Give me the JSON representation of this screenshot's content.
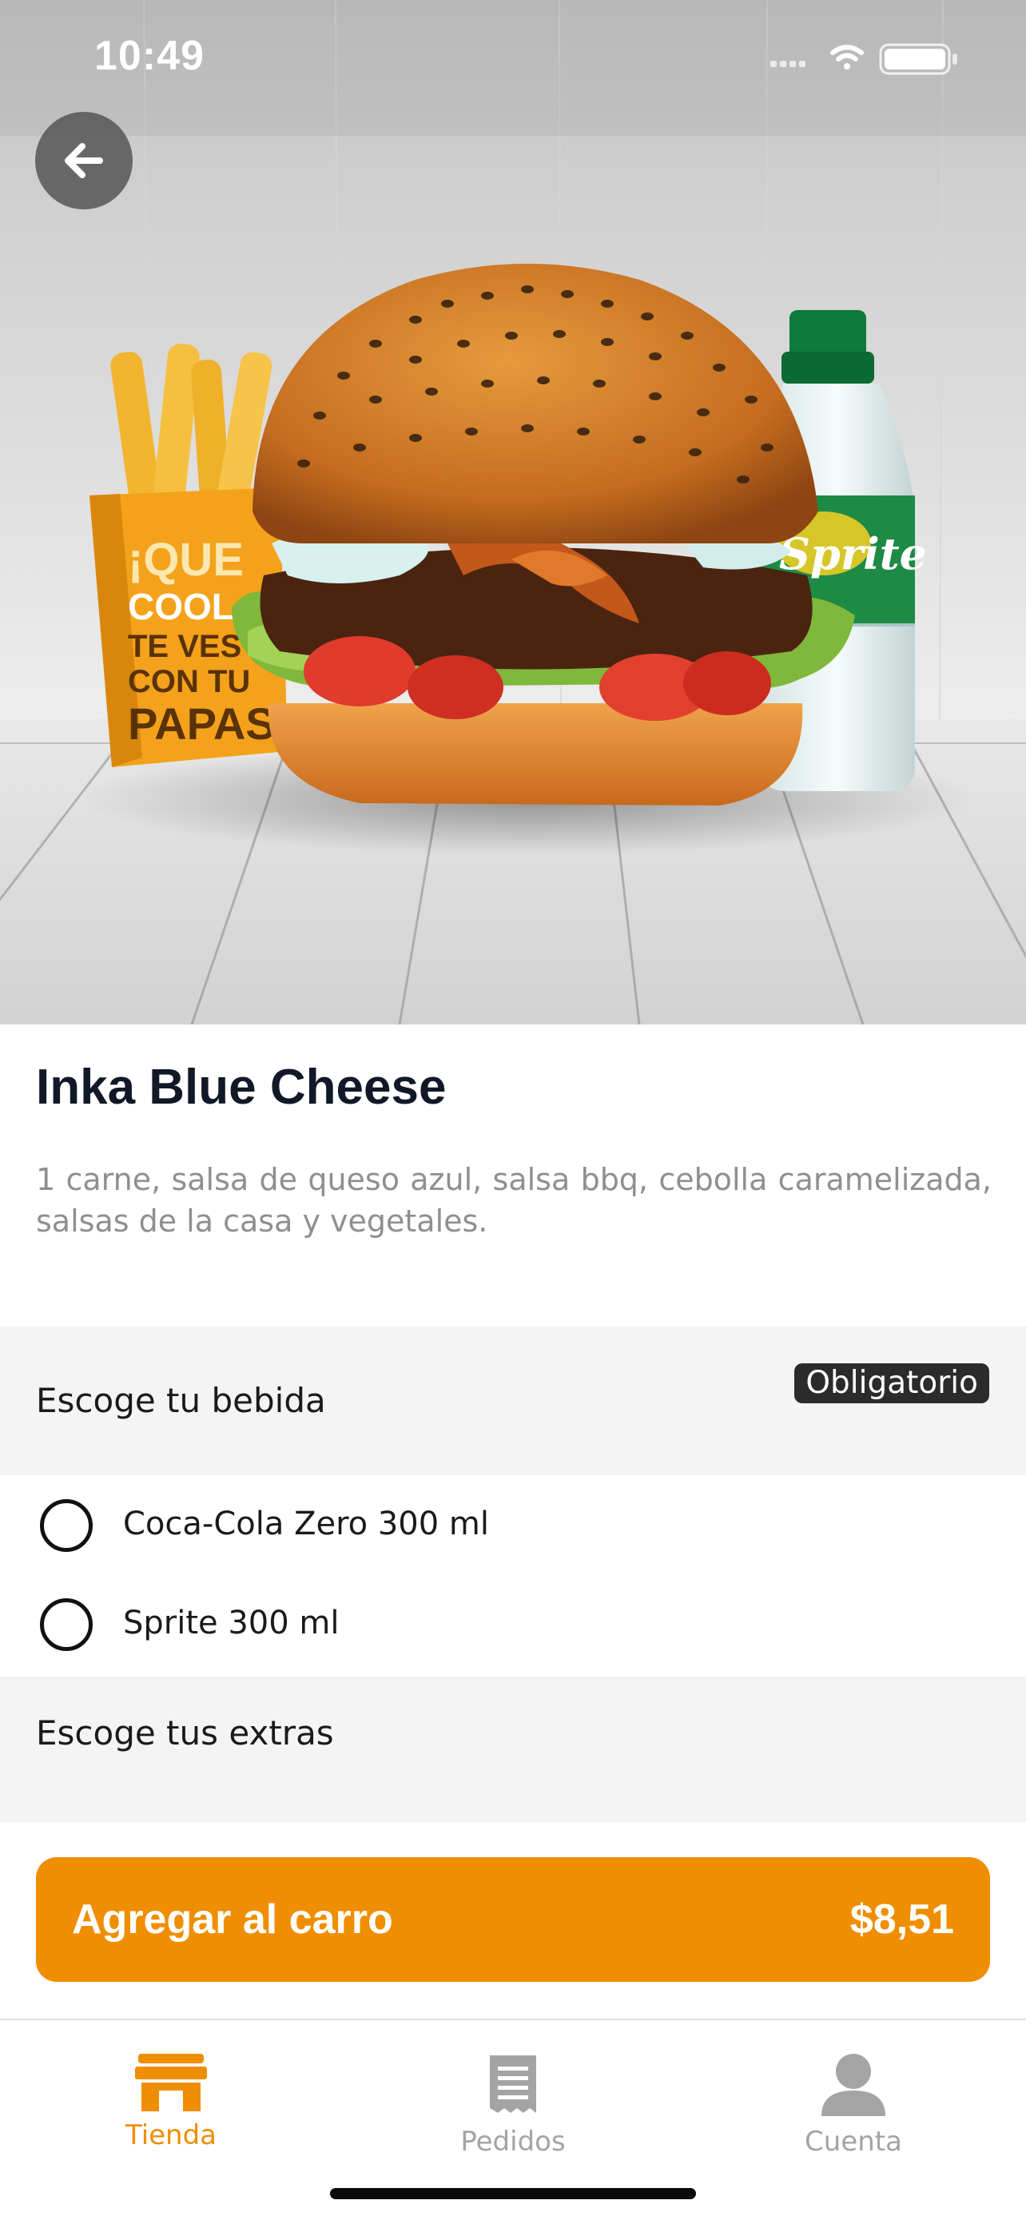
{
  "status_bar": {
    "time": "10:49",
    "icons": [
      "signal-icon",
      "wifi-icon",
      "battery-icon"
    ]
  },
  "header": {
    "back_icon": "arrow-left-icon"
  },
  "product": {
    "name": "Inka Blue Cheese",
    "description": "1 carne, salsa de queso azul, salsa bbq, cebolla caramelizada, salsas de la casa y vegetales."
  },
  "drink_section": {
    "label": "Escoge tu bebida",
    "badge": "Obligatorio",
    "options": [
      {
        "label": "Coca-Cola Zero 300 ml",
        "selected": false
      },
      {
        "label": "Sprite 300 ml",
        "selected": false
      }
    ]
  },
  "extras_section": {
    "label": "Escoge tus extras"
  },
  "cart_button": {
    "label": "Agregar al carro",
    "price": "$8,51"
  },
  "tabbar": {
    "tabs": [
      {
        "label": "Tienda",
        "icon": "store-icon",
        "active": true
      },
      {
        "label": "Pedidos",
        "icon": "receipt-icon",
        "active": false
      },
      {
        "label": "Cuenta",
        "icon": "user-icon",
        "active": false
      }
    ]
  },
  "colors": {
    "accent": "#ef8e00",
    "badge_bg": "#2b2b2b",
    "section_bg": "#f4f4f4",
    "inactive_tab": "#a4a4a4"
  }
}
